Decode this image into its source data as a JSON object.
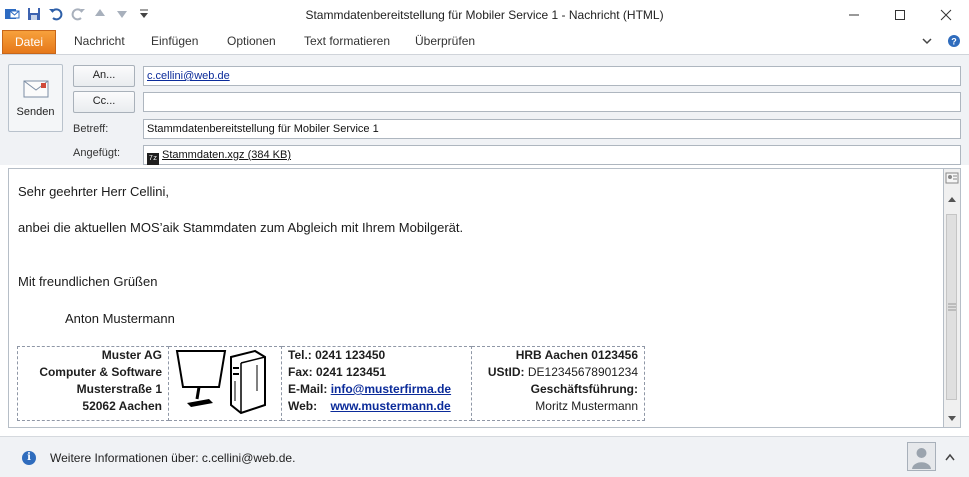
{
  "window": {
    "title": "Stammdatenbereitstellung für Mobiler Service 1  -  Nachricht (HTML)"
  },
  "ribbon": {
    "tabs": [
      "Datei",
      "Nachricht",
      "Einfügen",
      "Optionen",
      "Text formatieren",
      "Überprüfen"
    ]
  },
  "compose": {
    "send_label": "Senden",
    "to_button": "An...",
    "cc_button": "Cc...",
    "to_value": "c.cellini@web.de",
    "cc_value": "",
    "subject_label": "Betreff:",
    "subject_value": "Stammdatenbereitstellung für Mobiler Service 1",
    "attached_label": "Angefügt:",
    "attachment": {
      "icon_text": "7z",
      "name": "Stammdaten.xgz (384 KB)"
    }
  },
  "body": {
    "greeting": "Sehr geehrter Herr Cellini,",
    "line1": "anbei die aktuellen MOS’aik Stammdaten zum Abgleich mit Ihrem Mobilgerät.",
    "closing": "Mit freundlichen Grüßen",
    "sender": "Anton Mustermann"
  },
  "signature": {
    "company": [
      "Muster AG",
      "Computer & Software",
      "Musterstraße 1",
      "52062 Aachen"
    ],
    "tel_label": "Tel.:",
    "tel_value": "0241 123450",
    "fax_label": "Fax:",
    "fax_value": "0241 123451",
    "email_label": "E-Mail:",
    "email_value": "info@musterfirma.de",
    "web_label": "Web:",
    "web_value": "www.mustermann.de",
    "hrb": "HRB Aachen 0123456",
    "ustid_label": "UStID:",
    "ustid_value": "DE12345678901234",
    "gf_label": "Geschäftsführung:",
    "gf_value": "Moritz Mustermann"
  },
  "status": {
    "text": "Weitere Informationen über: c.cellini@web.de."
  },
  "colors": {
    "file_tab": "#e6781a",
    "link": "#0b2b9a",
    "info": "#2f6cbd"
  }
}
